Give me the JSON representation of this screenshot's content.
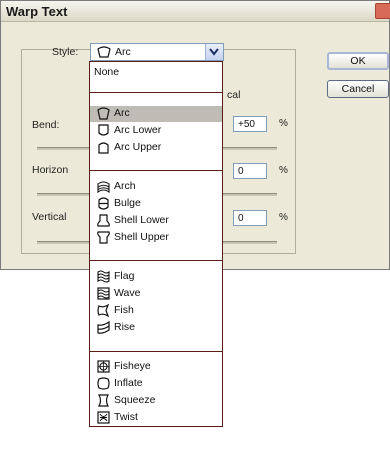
{
  "dialog": {
    "title": "Warp Text",
    "ok_label": "OK",
    "cancel_label": "Cancel"
  },
  "style": {
    "label": "Style:",
    "selected": "Arc",
    "selected_icon": "arc-icon"
  },
  "orientation": {
    "visible_tail": "cal"
  },
  "params": {
    "bend": {
      "label": "Bend:",
      "value": "+50",
      "unit": "%"
    },
    "horizontal": {
      "label": "Horizon",
      "value": "0",
      "unit": "%"
    },
    "vertical": {
      "label": "Vertical",
      "value": "0",
      "unit": "%"
    }
  },
  "dropdown": {
    "none_label": "None",
    "items": [
      {
        "label": "Arc",
        "icon": "arc-icon",
        "selected": true
      },
      {
        "label": "Arc Lower",
        "icon": "arc-lower-icon"
      },
      {
        "label": "Arc Upper",
        "icon": "arc-upper-icon"
      },
      {
        "label": "Arch",
        "icon": "arch-icon"
      },
      {
        "label": "Bulge",
        "icon": "bulge-icon"
      },
      {
        "label": "Shell Lower",
        "icon": "shell-lower-icon"
      },
      {
        "label": "Shell Upper",
        "icon": "shell-upper-icon"
      },
      {
        "label": "Flag",
        "icon": "flag-icon"
      },
      {
        "label": "Wave",
        "icon": "wave-icon"
      },
      {
        "label": "Fish",
        "icon": "fish-icon"
      },
      {
        "label": "Rise",
        "icon": "rise-icon"
      },
      {
        "label": "Fisheye",
        "icon": "fisheye-icon"
      },
      {
        "label": "Inflate",
        "icon": "inflate-icon"
      },
      {
        "label": "Squeeze",
        "icon": "squeeze-icon"
      },
      {
        "label": "Twist",
        "icon": "twist-icon"
      }
    ]
  },
  "colors": {
    "dialog_bg": "#ece9d8",
    "list_border": "#5a1e16",
    "selection": "#bfbcb5"
  }
}
